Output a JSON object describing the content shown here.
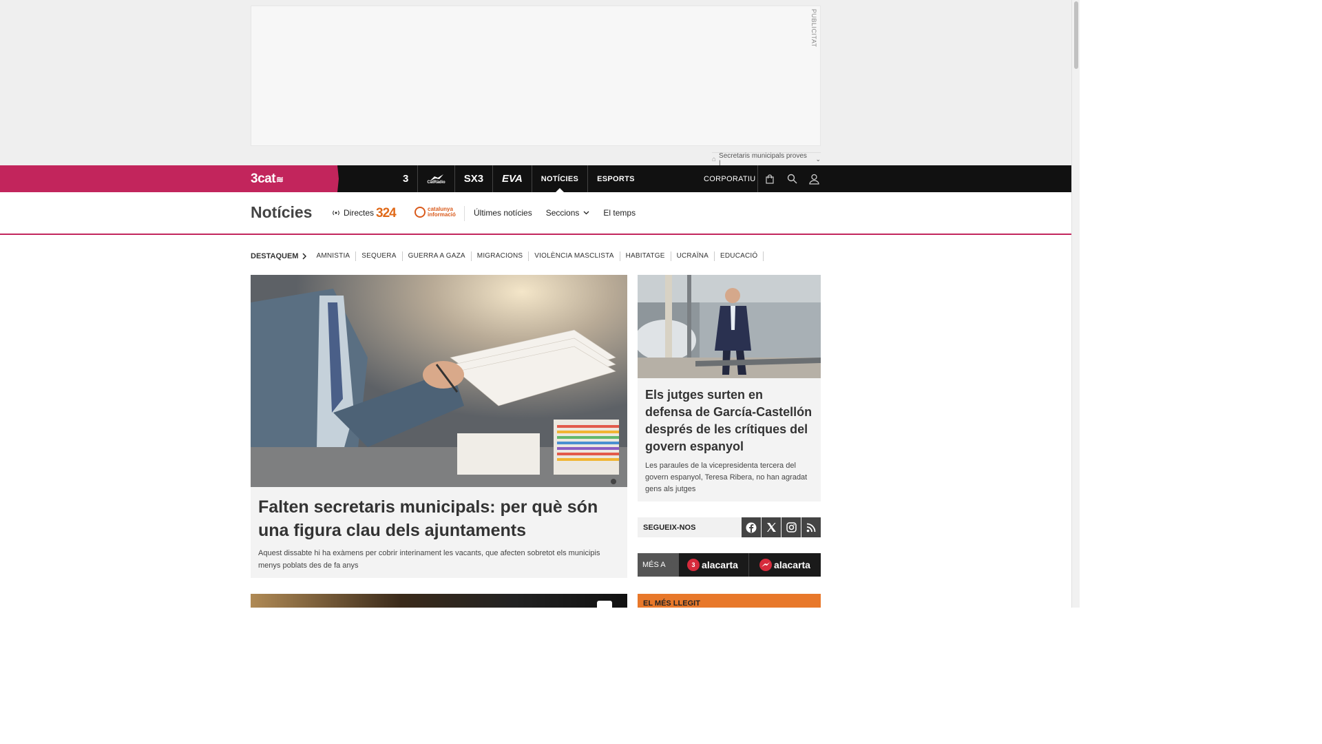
{
  "ad": {
    "label": "PUBLICITAT",
    "topic_selector": "Secretaris municipals proves |"
  },
  "topbar": {
    "brand": "3cat",
    "channels": [
      {
        "label": "3",
        "name": "tv3"
      },
      {
        "label": "CatRàdio",
        "name": "catradio"
      },
      {
        "label": "SX3",
        "name": "sx3"
      },
      {
        "label": "EVA",
        "name": "eva"
      },
      {
        "label": "NOTÍCIES",
        "name": "noticies"
      },
      {
        "label": "ESPORTS",
        "name": "esports"
      }
    ],
    "corporate": "CORPORATIU"
  },
  "section": {
    "title": "Notícies",
    "directes": "Directes",
    "logo_324": "324",
    "logo_catinfo_line1": "catalunya",
    "logo_catinfo_line2": "informació",
    "links": [
      "Últimes notícies",
      "Seccions",
      "El temps"
    ]
  },
  "highlights": {
    "lead": "DESTAQUEM",
    "tags": [
      "AMNISTIA",
      "SEQUERA",
      "GUERRA A GAZA",
      "MIGRACIONS",
      "VIOLÈNCIA MASCLISTA",
      "HABITATGE",
      "UCRAÏNA",
      "EDUCACIÓ"
    ]
  },
  "main_story": {
    "title": "Falten secretaris municipals: per què són una figura clau dels ajuntaments",
    "subtitle": "Aquest dissabte hi ha exàmens per cobrir interinament les vacants, que afecten sobretot els municipis menys poblats des de fa anys"
  },
  "side_story": {
    "title": "Els jutges surten en defensa de García-Castellón després de les crítiques del govern espanyol",
    "subtitle": "Les paraules de la vicepresidenta tercera del govern espanyol, Teresa Ribera, no han agradat gens als jutges"
  },
  "follow": {
    "label": "SEGUEIX-NOS"
  },
  "alacarta": {
    "label": "MÉS A",
    "items": [
      {
        "badge": "3",
        "text": "alacarta"
      },
      {
        "badge": "",
        "text": "alacarta"
      }
    ]
  },
  "most_read": {
    "label": "EL MÉS LLEGIT"
  },
  "colors": {
    "brand": "#c2255c",
    "topbar": "#111111",
    "accent_orange": "#e8782a"
  }
}
